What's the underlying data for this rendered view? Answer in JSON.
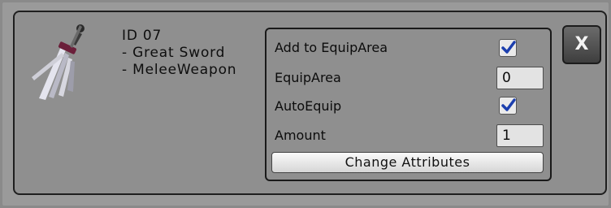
{
  "item": {
    "id_text": "ID 07",
    "name": "- Great Sword",
    "category": "- MeleeWeapon",
    "icon": "great-sword-icon"
  },
  "attributes": {
    "add_to_equip_area": {
      "label": "Add to EquipArea",
      "checked": true
    },
    "equip_area": {
      "label": "EquipArea",
      "value": "0"
    },
    "auto_equip": {
      "label": "AutoEquip",
      "checked": true
    },
    "amount": {
      "label": "Amount",
      "value": "1"
    },
    "change_button_label": "Change Attributes"
  },
  "close_button": {
    "label": "X"
  },
  "colors": {
    "checkmark": "#1c3fae",
    "panel": "#8f8f8f",
    "close_button": "#545454"
  }
}
